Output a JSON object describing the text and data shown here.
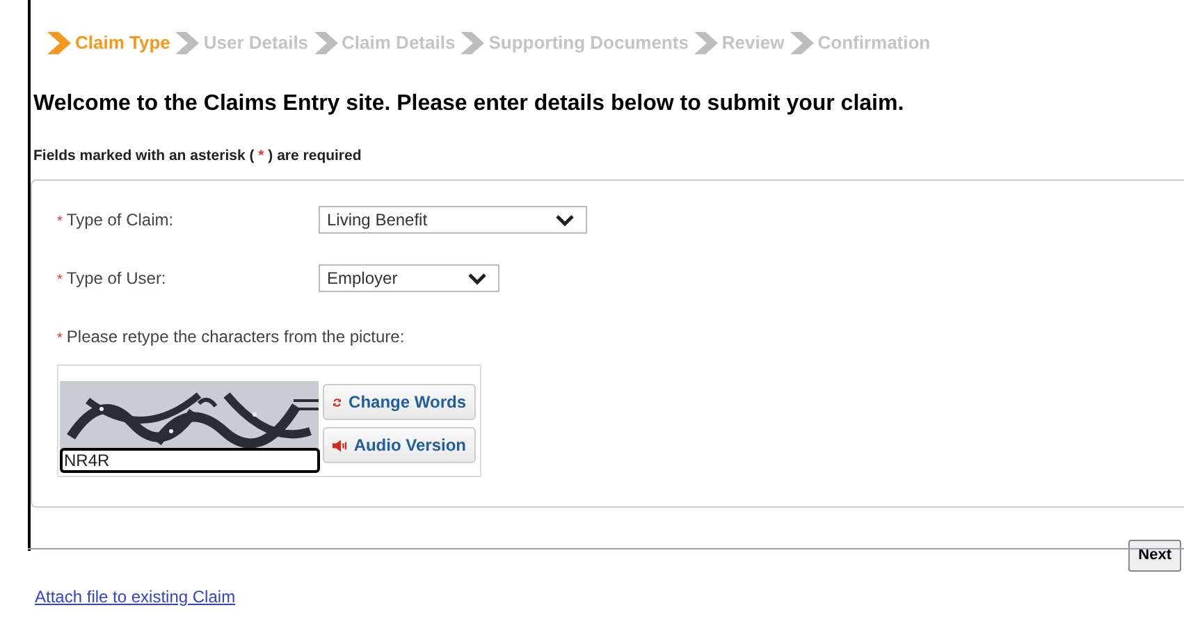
{
  "steps": [
    {
      "label": "Claim Type",
      "selected": true
    },
    {
      "label": "User Details",
      "selected": false
    },
    {
      "label": "Claim Details",
      "selected": false
    },
    {
      "label": "Supporting Documents",
      "selected": false
    },
    {
      "label": "Review",
      "selected": false
    },
    {
      "label": "Confirmation",
      "selected": false
    }
  ],
  "heading": "Welcome to the Claims Entry site. Please enter details below to submit your claim.",
  "required_note": {
    "before": "Fields marked with an asterisk (",
    "mark": "*",
    "after": ") are required"
  },
  "fields": [
    {
      "mark": "*",
      "label": "Type of Claim:",
      "value": "Living Benefit",
      "wide": true
    },
    {
      "mark": "*",
      "label": "Type of User:",
      "value": "Employer",
      "wide": false
    }
  ],
  "captcha": {
    "mark": "*",
    "label": "Please retype the characters from the picture:",
    "value": "NR4R",
    "buttons": [
      {
        "kind": "refresh",
        "label": "Change Words"
      },
      {
        "kind": "audio",
        "label": "Audio Version"
      }
    ]
  },
  "next_button": "Next",
  "attach_link": "Attach file to existing Claim"
}
